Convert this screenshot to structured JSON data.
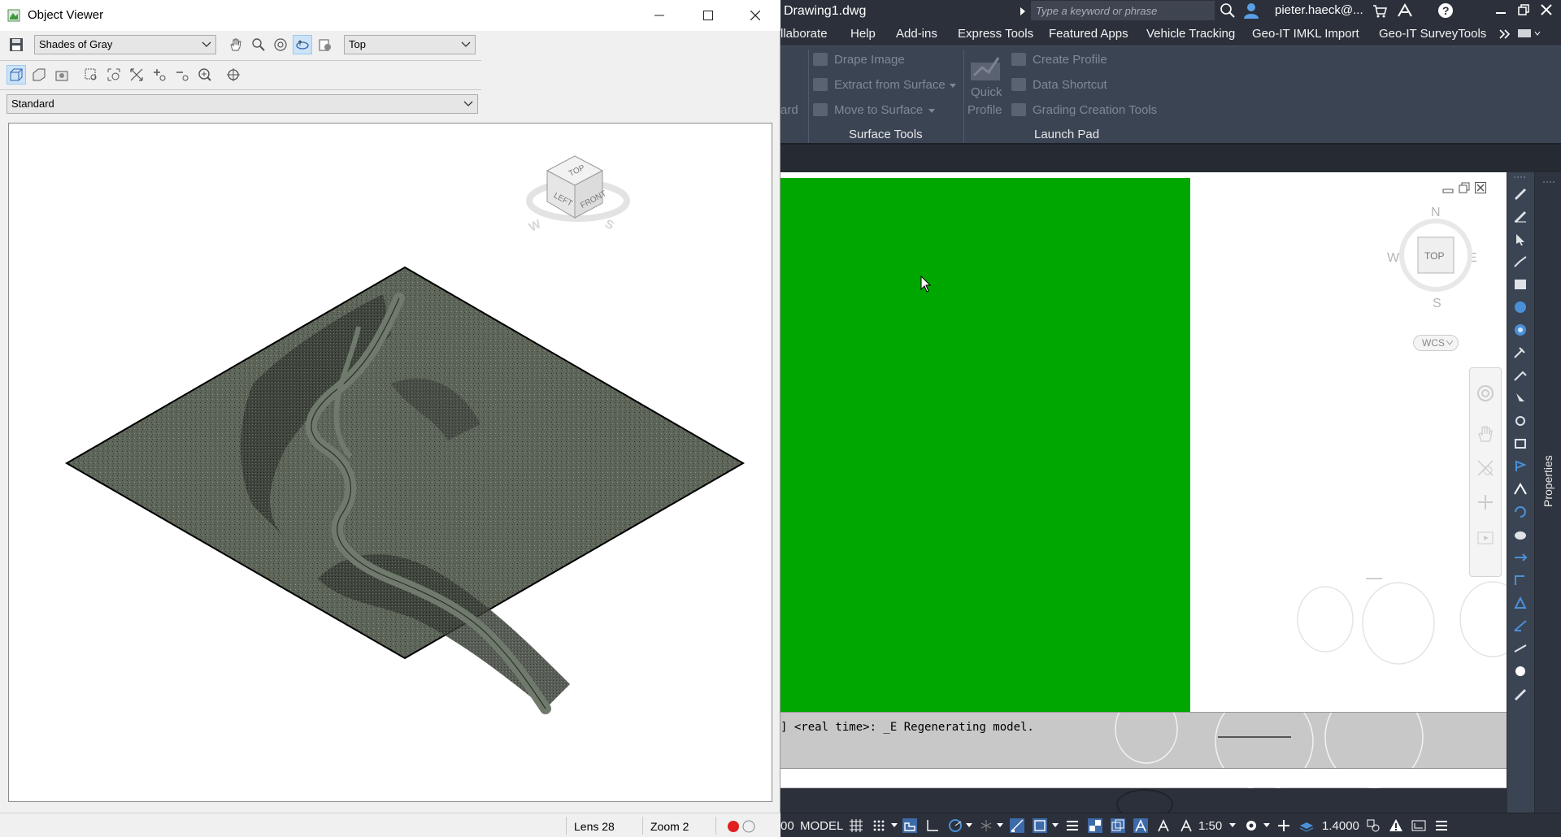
{
  "object_viewer": {
    "title": "Object Viewer",
    "visual_style": "Shades of Gray",
    "view_direction": "Top",
    "view_mode": "Standard",
    "viewcube": {
      "top": "TOP",
      "left": "LEFT",
      "front": "FRONT",
      "west": "W",
      "south": "S"
    },
    "status": {
      "lens": "Lens 28",
      "zoom": "Zoom 2"
    },
    "surface_fill": "#5e665a",
    "river_fill": "#6f7a6c"
  },
  "civil3d": {
    "filename": "Drawing1.dwg",
    "search_placeholder": "Type a keyword or phrase",
    "user": "pieter.haeck@...",
    "menu": [
      "llaborate",
      "Help",
      "Add-ins",
      "Express Tools",
      "Featured Apps",
      "Vehicle Tracking",
      "Geo-IT IMKL Import",
      "Geo-IT SurveyTools"
    ],
    "ribbon": {
      "surface_tools": {
        "items": [
          "Drape Image",
          "Extract from Surface",
          "Move to Surface"
        ],
        "group_label": "Surface Tools"
      },
      "partial_label": "ard",
      "launch_pad": {
        "quick_profile": [
          "Quick",
          "Profile"
        ],
        "items": [
          "Create Profile",
          "Data Shortcut",
          "Grading Creation Tools"
        ],
        "group_label": "Launch Pad"
      }
    },
    "compass": {
      "n": "N",
      "s": "S",
      "e": "E",
      "w": "W",
      "top": "TOP",
      "ucs": "WCS"
    },
    "command_history": "] <real time>: _E Regenerating model.",
    "properties_label": "Properties",
    "status": {
      "left_partial": "00",
      "model": "MODEL",
      "scale": "1:50",
      "lineweight": "1.4000"
    },
    "green_fill": "#00a700"
  }
}
